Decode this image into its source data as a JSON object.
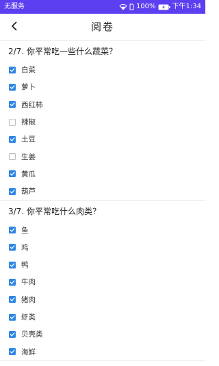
{
  "status_bar": {
    "carrier": "无服务",
    "battery": "100%",
    "time": "下午1:34"
  },
  "header": {
    "title": "阅卷"
  },
  "questions": [
    {
      "title": "2/7. 你平常吃一些什么蔬菜？",
      "options": [
        {
          "label": "白菜",
          "checked": true
        },
        {
          "label": "萝卜",
          "checked": true
        },
        {
          "label": "西红柿",
          "checked": true
        },
        {
          "label": "辣椒",
          "checked": false
        },
        {
          "label": "土豆",
          "checked": true
        },
        {
          "label": "生姜",
          "checked": false
        },
        {
          "label": "黄瓜",
          "checked": true
        },
        {
          "label": "葫芦",
          "checked": true
        }
      ]
    },
    {
      "title": "3/7. 你平常吃什么肉类？",
      "options": [
        {
          "label": "鱼",
          "checked": true
        },
        {
          "label": "鸡",
          "checked": true
        },
        {
          "label": "鸭",
          "checked": true
        },
        {
          "label": "牛肉",
          "checked": true
        },
        {
          "label": "猪肉",
          "checked": true
        },
        {
          "label": "虾类",
          "checked": true
        },
        {
          "label": "贝壳类",
          "checked": true
        },
        {
          "label": "海鲜",
          "checked": true
        }
      ]
    }
  ],
  "colors": {
    "status_bar": "#5b3ff0",
    "checkbox_checked": "#2e86e6",
    "checkbox_unchecked_border": "#bdbdbd"
  }
}
